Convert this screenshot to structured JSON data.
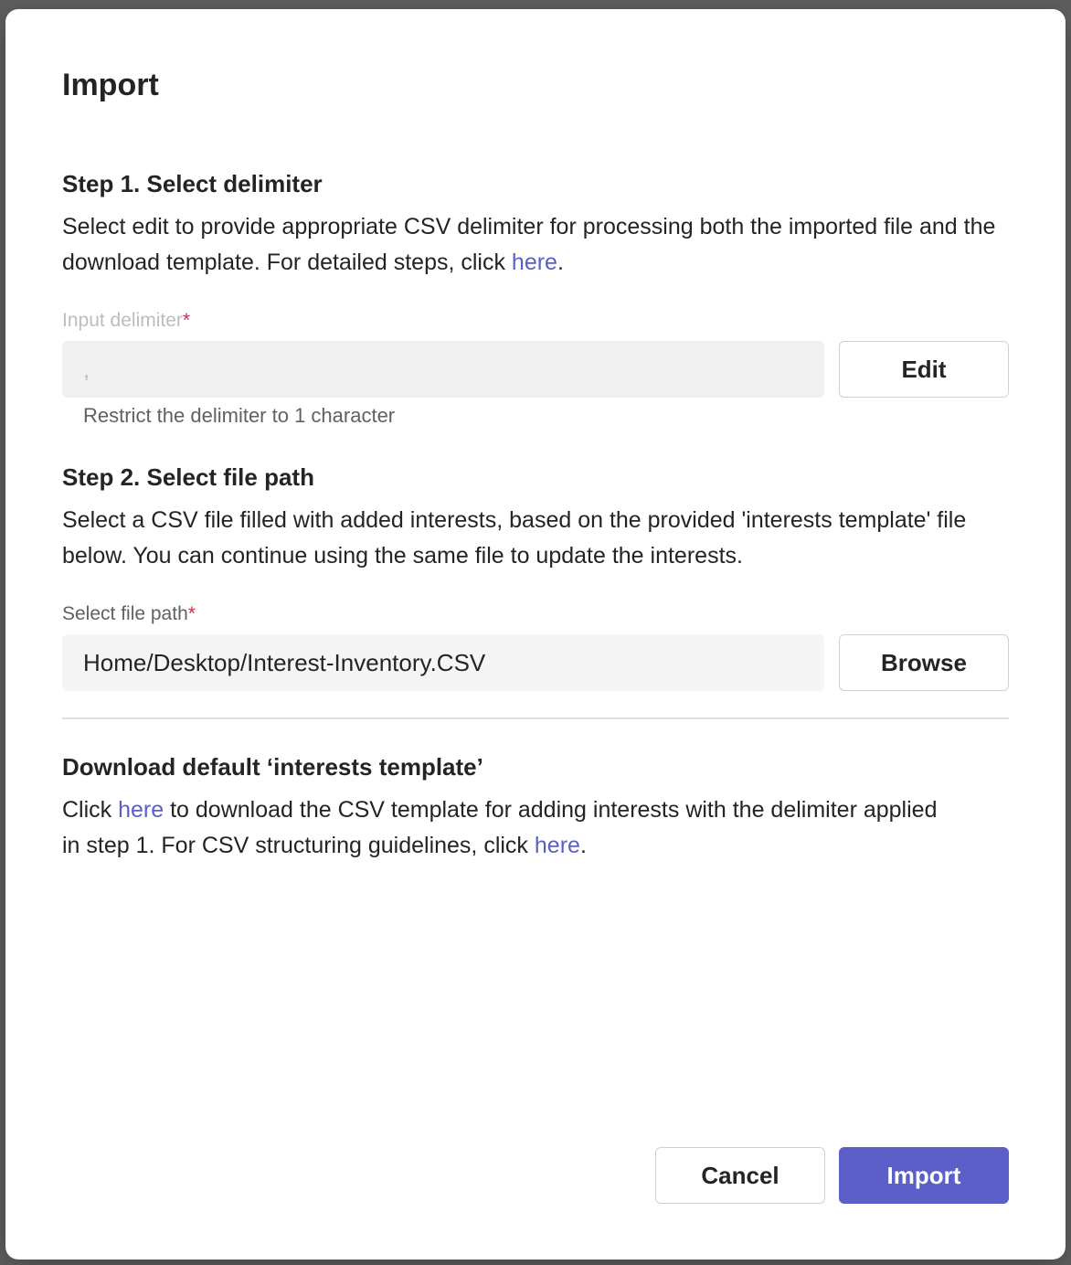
{
  "dialog": {
    "title": "Import"
  },
  "step1": {
    "heading": "Step 1. Select delimiter",
    "desc_text": "Select edit to provide appropriate CSV delimiter for processing both the imported file and the download template. For detailed steps, click ",
    "desc_link": "here",
    "desc_end": ".",
    "field_label": "Input delimiter",
    "required_mark": "*",
    "value": ",",
    "edit_label": "Edit",
    "hint": "Restrict the delimiter to 1 character"
  },
  "step2": {
    "heading": "Step 2. Select file path",
    "desc": "Select a CSV file filled with added interests, based on the provided 'interests template' file below. You can continue using the same file to update the interests.",
    "field_label": "Select file path",
    "required_mark": "*",
    "value": "Home/Desktop/Interest-Inventory.CSV",
    "browse_label": "Browse"
  },
  "download": {
    "heading": "Download default ‘interests template’",
    "text_1": "Click ",
    "link_1": "here",
    "text_2": " to download the CSV template for adding interests with the delimiter applied in step 1. For CSV structuring guidelines, click ",
    "link_2": "here",
    "text_3": "."
  },
  "footer": {
    "cancel_label": "Cancel",
    "import_label": "Import"
  },
  "colors": {
    "accent": "#5b5fc7",
    "required": "#c4314b"
  }
}
